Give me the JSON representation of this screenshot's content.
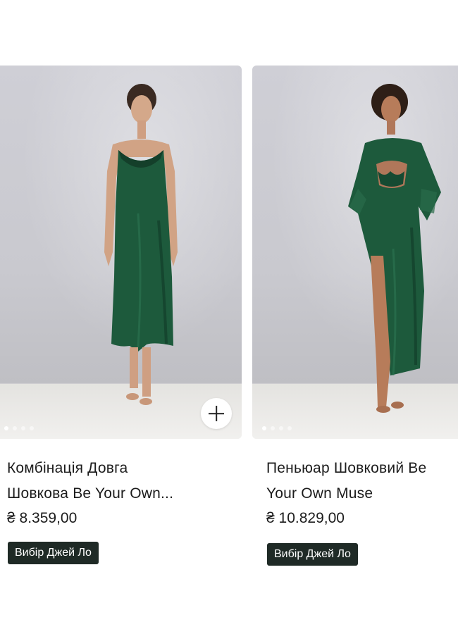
{
  "products": [
    {
      "title_line1": "Комбінація Довга",
      "title_line2": "Шовкова Be Your Own...",
      "price": "₴ 8.359,00",
      "badge": "Вибір Джей Ло",
      "carousel_pages": 4,
      "carousel_active": 1
    },
    {
      "title_line1": "Пеньюар Шовковий Be",
      "title_line2": "Your Own Muse",
      "price": "₴ 10.829,00",
      "badge": "Вибір Джей Ло",
      "carousel_pages": 4,
      "carousel_active": 1
    }
  ],
  "icons": {
    "add": "plus-icon"
  },
  "colors": {
    "garment": "#1d5a3c",
    "badge_bg": "#1f2a26",
    "wall": "#cbcbd1"
  }
}
